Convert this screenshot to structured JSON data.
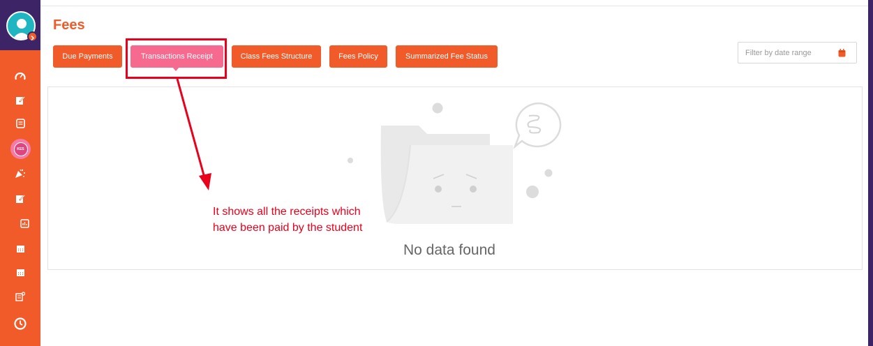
{
  "page": {
    "title": "Fees"
  },
  "tabs": [
    {
      "label": "Due Payments",
      "active": false
    },
    {
      "label": "Transactions Receipt",
      "active": true
    },
    {
      "label": "Class Fees Structure",
      "active": false
    },
    {
      "label": "Fees Policy",
      "active": false
    },
    {
      "label": "Summarized Fee Status",
      "active": false
    }
  ],
  "filter": {
    "placeholder": "Filter by date range",
    "icon": "calendar-icon"
  },
  "empty_state": {
    "message": "No data found"
  },
  "annotation": {
    "text": "It shows all the receipts which have been paid by the student"
  },
  "sidebar": {
    "badge_label": "KES",
    "icons": [
      "dashboard-icon",
      "edit-icon",
      "notes-icon",
      "fees-icon",
      "party-icon",
      "edit-icon",
      "report-icon",
      "calendar-icon",
      "calendar-icon",
      "checklist-icon",
      "clock-icon"
    ]
  },
  "colors": {
    "brand": "#f15a29",
    "active_tab": "#f56a8e",
    "sidebar_dark": "#3d2466",
    "annotation": "#e8001c"
  }
}
